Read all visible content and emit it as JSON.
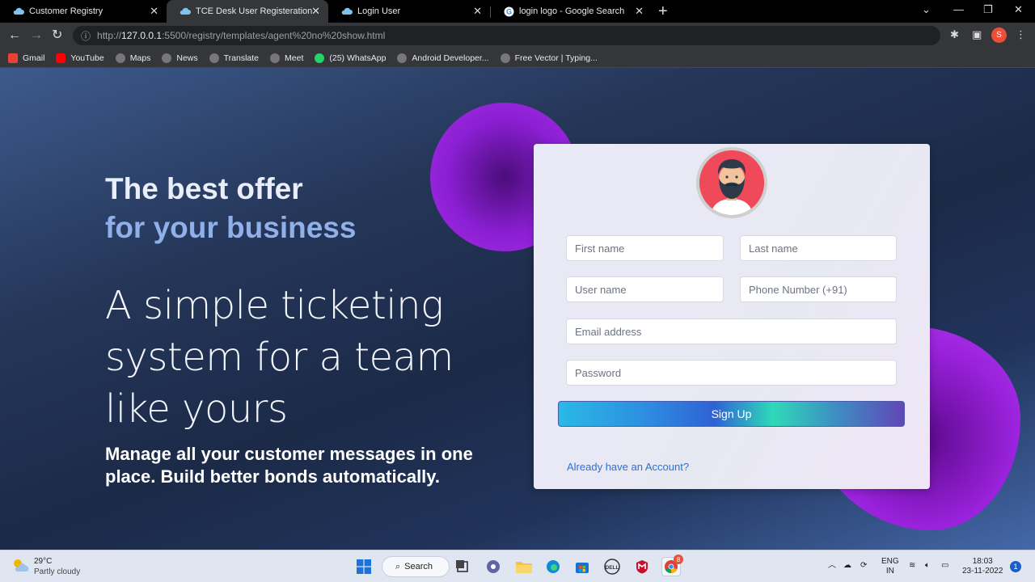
{
  "browser": {
    "tabs": [
      {
        "title": "Customer Registry",
        "favicon": "cloud-icon"
      },
      {
        "title": "TCE Desk User Registeration",
        "favicon": "cloud-icon",
        "active": true
      },
      {
        "title": "Login User",
        "favicon": "cloud-icon"
      },
      {
        "title": "login logo - Google Search",
        "favicon": "google-icon"
      }
    ],
    "url_scheme": "http://",
    "url_host": "127.0.0.1",
    "url_rest": ":5500/registry/templates/agent%20no%20show.html",
    "profile_initial": "S",
    "bookmarks": [
      {
        "label": "Gmail",
        "color": "#ea4335"
      },
      {
        "label": "YouTube",
        "color": "#ff0000"
      },
      {
        "label": "Maps",
        "color": "#888888"
      },
      {
        "label": "News",
        "color": "#888888"
      },
      {
        "label": "Translate",
        "color": "#888888"
      },
      {
        "label": "Meet",
        "color": "#888888"
      },
      {
        "label": "(25) WhatsApp",
        "color": "#25d366"
      },
      {
        "label": "Android Developer...",
        "color": "#888888"
      },
      {
        "label": "Free Vector | Typing...",
        "color": "#888888"
      }
    ]
  },
  "hero": {
    "title": "The best offer",
    "subtitle": "for your business",
    "tagline": "A simple ticketing system for a team like yours",
    "description": "Manage all your customer messages in one place. Build better bonds automatically."
  },
  "form": {
    "first_name_placeholder": "First name",
    "last_name_placeholder": "Last name",
    "username_placeholder": "User name",
    "phone_placeholder": "Phone Number (+91)",
    "email_placeholder": "Email address",
    "password_placeholder": "Password",
    "signup_label": "Sign Up",
    "login_link": "Already have an Account?"
  },
  "taskbar": {
    "temperature": "29°C",
    "weather": "Partly cloudy",
    "search_label": "Search",
    "lang": "ENG",
    "region": "IN",
    "time": "18:03",
    "date": "23-11-2022",
    "notifications": "1",
    "chrome_badge": "8"
  }
}
